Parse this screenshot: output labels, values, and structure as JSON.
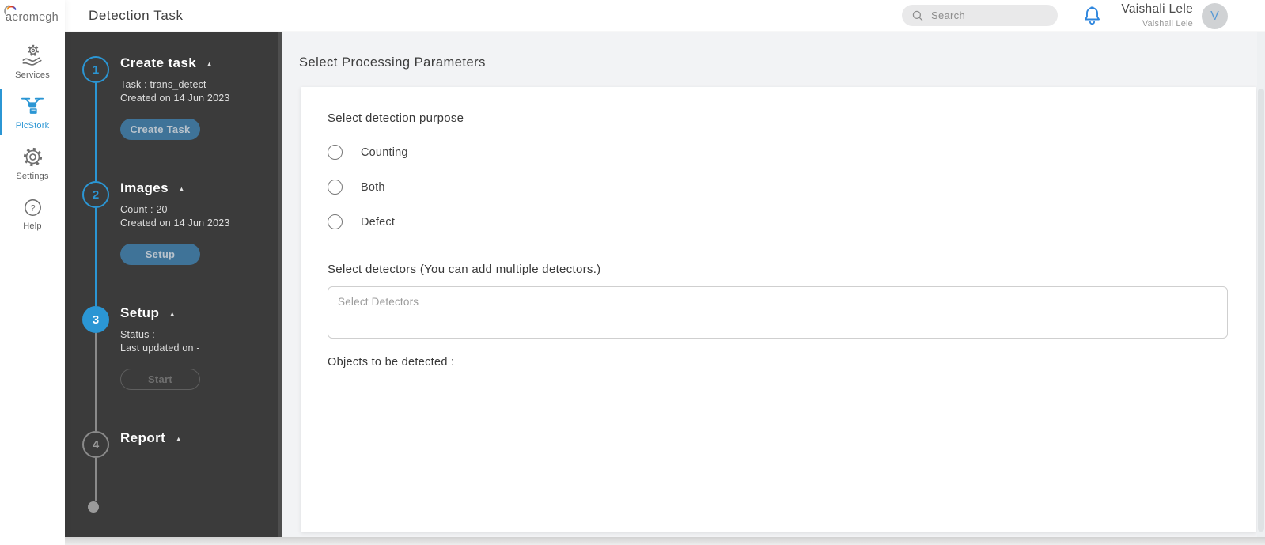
{
  "app": {
    "logo_text": "aeromegh",
    "page_title": "Detection Task"
  },
  "topbar": {
    "search_placeholder": "Search",
    "user_name": "Vaishali Lele",
    "user_subtitle": "Vaishali Lele",
    "avatar_letter": "V"
  },
  "nav": {
    "items": [
      {
        "label": "Services",
        "icon": "gear-in-hand-icon",
        "active": false
      },
      {
        "label": "PicStork",
        "icon": "drone-icon",
        "active": true
      },
      {
        "label": "Settings",
        "icon": "gear-icon",
        "active": false
      },
      {
        "label": "Help",
        "icon": "question-circle-icon",
        "active": false
      }
    ]
  },
  "stepper": {
    "steps": [
      {
        "number": "1",
        "title": "Create task",
        "state": "done",
        "lines": [
          "Task : trans_detect",
          "Created on 14 Jun 2023"
        ],
        "button_label": "Create Task",
        "button_style": "filled"
      },
      {
        "number": "2",
        "title": "Images",
        "state": "done",
        "lines": [
          "Count : 20",
          "Created on 14 Jun 2023"
        ],
        "button_label": "Setup",
        "button_style": "filled"
      },
      {
        "number": "3",
        "title": "Setup",
        "state": "current",
        "lines": [
          "Status : -",
          "Last updated on -"
        ],
        "button_label": "Start",
        "button_style": "outline"
      },
      {
        "number": "4",
        "title": "Report",
        "state": "future",
        "lines": [
          "-"
        ]
      }
    ]
  },
  "main": {
    "title": "Select Processing Parameters",
    "purpose_label": "Select detection purpose",
    "purpose_options": [
      "Counting",
      "Both",
      "Defect"
    ],
    "detectors_label": "Select detectors (You can add multiple detectors.)",
    "detectors_placeholder": "Select Detectors",
    "objects_label": "Objects to be detected :"
  },
  "colors": {
    "accent_blue": "#2b96d4",
    "stepper_panel": "#3b3b3b",
    "disabled_button_blue": "#3f7398",
    "main_background": "#f2f3f5"
  }
}
